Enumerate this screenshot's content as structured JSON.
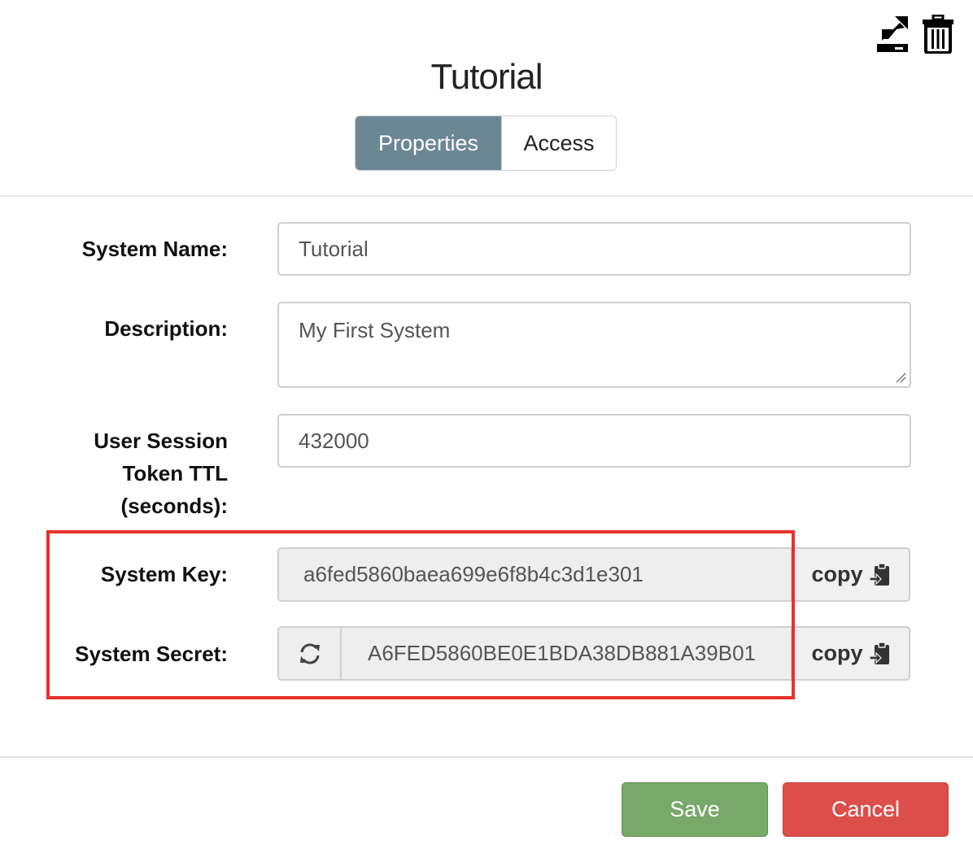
{
  "header": {
    "title": "Tutorial",
    "icons": [
      "export-icon",
      "trash-icon"
    ]
  },
  "tabs": [
    {
      "label": "Properties",
      "active": true
    },
    {
      "label": "Access",
      "active": false
    }
  ],
  "form": {
    "system_name": {
      "label": "System Name:",
      "value": "Tutorial"
    },
    "description": {
      "label": "Description:",
      "value": "My First System"
    },
    "ttl": {
      "label_lines": [
        "User Session",
        "Token TTL",
        "(seconds):"
      ],
      "value": "432000"
    },
    "system_key": {
      "label": "System Key:",
      "value": "a6fed5860baea699e6f8b4c3d1e301",
      "copy_label": "copy"
    },
    "system_secret": {
      "label": "System Secret:",
      "value": "A6FED5860BE0E1BDA38DB881A39B01",
      "copy_label": "copy"
    }
  },
  "footer": {
    "save_label": "Save",
    "cancel_label": "Cancel"
  },
  "colors": {
    "tab_active": "#6c8794",
    "highlight": "#e8322b",
    "save": "#78a86a",
    "cancel": "#dc4e4a"
  }
}
